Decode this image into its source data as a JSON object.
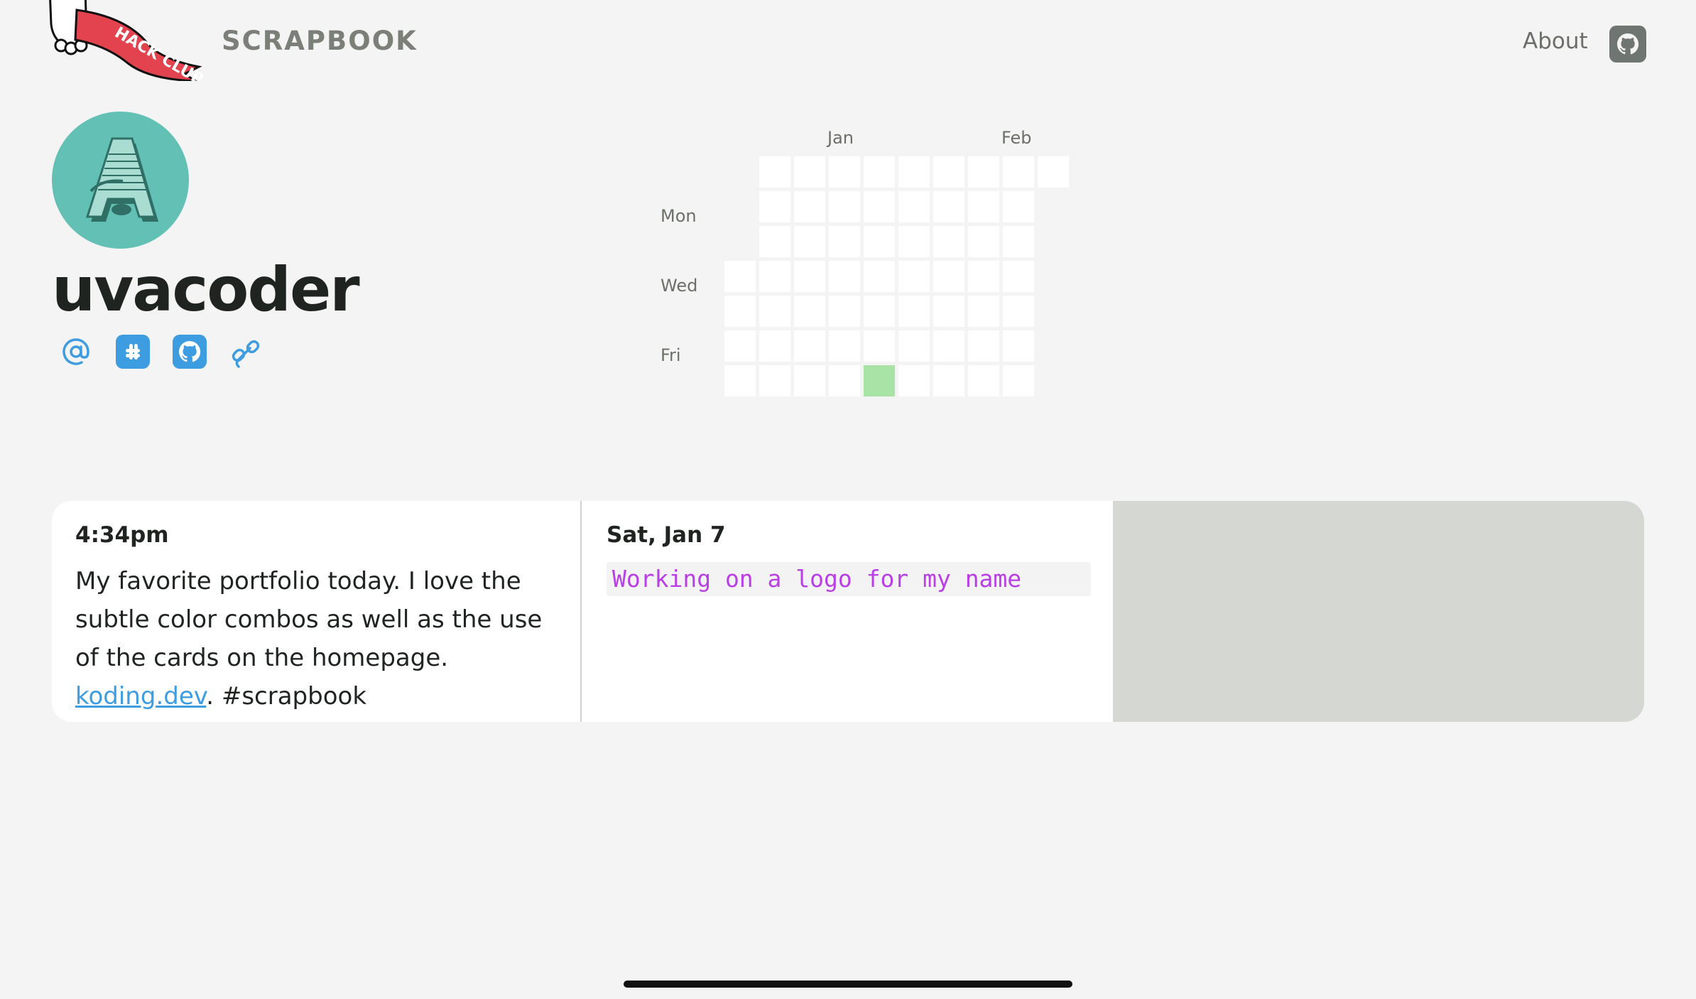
{
  "header": {
    "flag_text": "HACK CLUB",
    "brand": "SCRAPBOOK",
    "about": "About",
    "github_icon": "github-icon"
  },
  "profile": {
    "username": "uvacoder",
    "avatar_letter": "A",
    "avatar_color": "#63c0b4",
    "socials": [
      {
        "icon": "at-sign-icon"
      },
      {
        "icon": "slack-icon"
      },
      {
        "icon": "github-icon"
      },
      {
        "icon": "link-icon"
      }
    ],
    "accent": "#3d9de0"
  },
  "heatmap": {
    "months": [
      "Jan",
      "Feb"
    ],
    "days": [
      "Mon",
      "Wed",
      "Fri"
    ],
    "active_color": "#a9e3a6",
    "active_cells": [
      {
        "col": 4,
        "row": 6
      }
    ]
  },
  "posts": [
    {
      "time": "4:34pm",
      "text_before": "My favorite portfolio today. I love the subtle color combos as well as the use of the cards on the homepage. ",
      "link": "koding.dev",
      "text_after": ". #scrapbook"
    },
    {
      "time": "Sat, Jan 7",
      "code": "Working on a logo for my name"
    }
  ]
}
